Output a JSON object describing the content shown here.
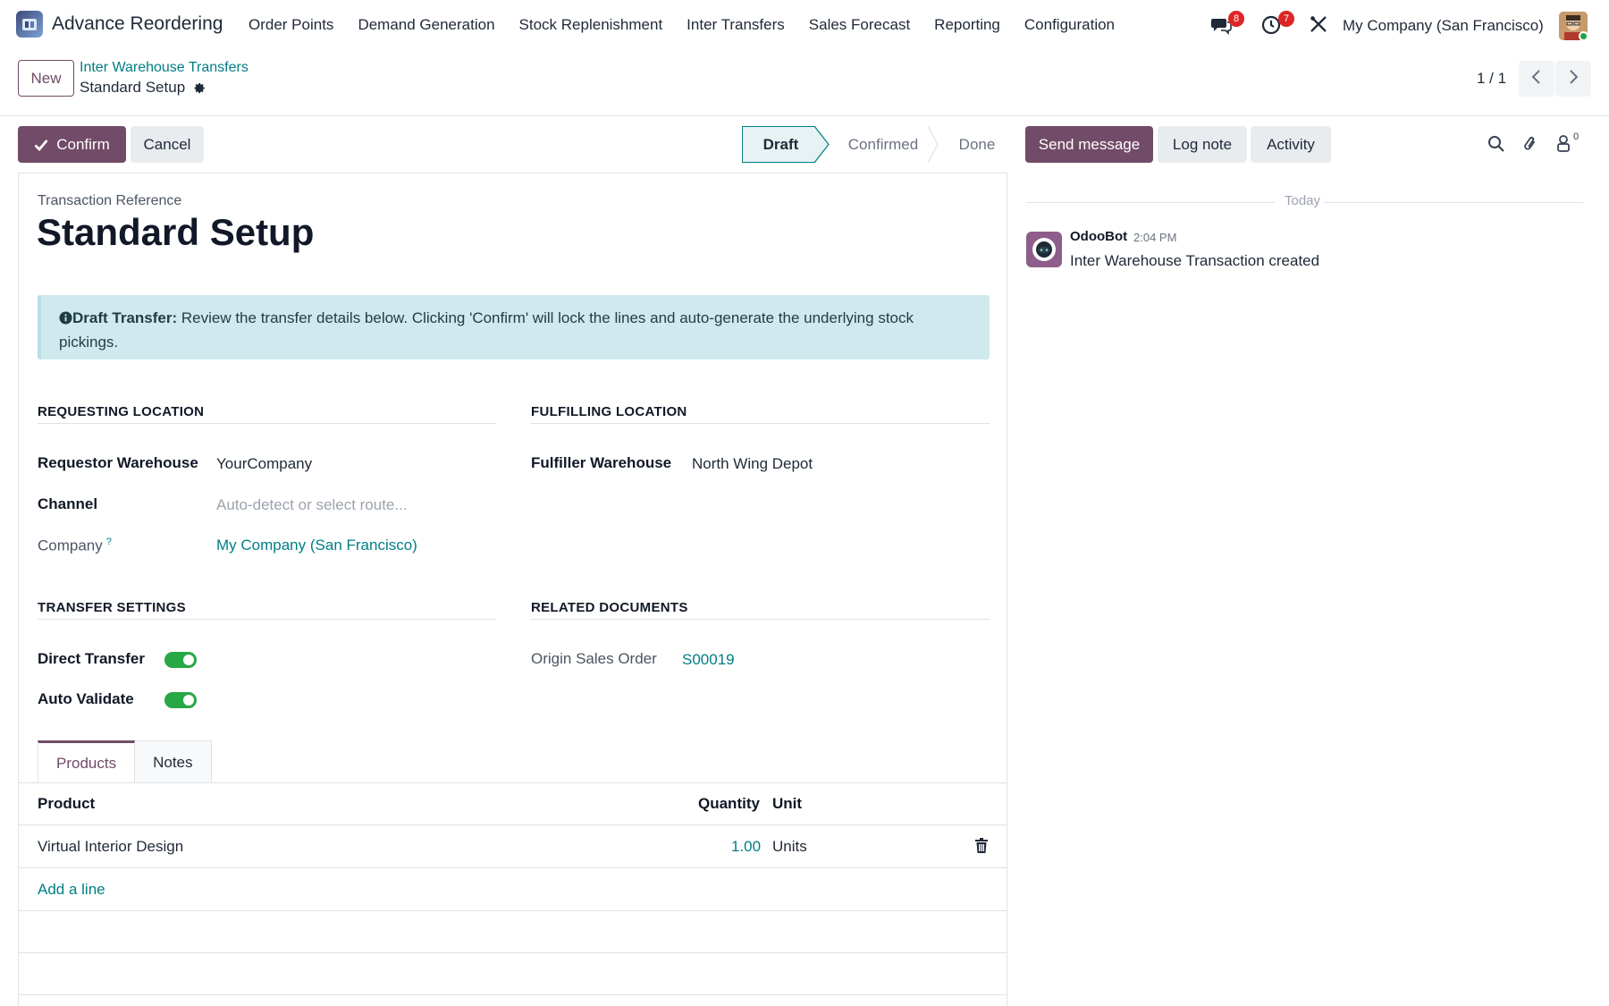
{
  "app": {
    "name": "Advance Reordering",
    "menu": [
      "Order Points",
      "Demand Generation",
      "Stock Replenishment",
      "Inter Transfers",
      "Sales Forecast",
      "Reporting",
      "Configuration"
    ],
    "messages_badge": "8",
    "activities_badge": "7",
    "company": "My Company (San Francisco)"
  },
  "control_panel": {
    "new_label": "New",
    "breadcrumb_parent": "Inter Warehouse Transfers",
    "breadcrumb_current": "Standard Setup",
    "pager": "1 / 1"
  },
  "actions": {
    "confirm": "Confirm",
    "cancel": "Cancel"
  },
  "status": {
    "stages": [
      "Draft",
      "Confirmed",
      "Done"
    ],
    "current": "Draft"
  },
  "form": {
    "reference_label": "Transaction Reference",
    "reference": "Standard Setup",
    "alert_title": "Draft Transfer:",
    "alert_text": "Review the transfer details below. Clicking 'Confirm' will lock the lines and auto-generate the underlying stock",
    "alert_text_2": "pickings.",
    "requesting": {
      "title": "REQUESTING LOCATION",
      "warehouse_label": "Requestor Warehouse",
      "warehouse": "YourCompany",
      "channel_label": "Channel",
      "channel_placeholder": "Auto-detect or select route...",
      "company_label": "Company",
      "company_help": "?",
      "company": "My Company (San Francisco)"
    },
    "fulfilling": {
      "title": "FULFILLING LOCATION",
      "warehouse_label": "Fulfiller Warehouse",
      "warehouse": "North Wing Depot"
    },
    "settings": {
      "title": "TRANSFER SETTINGS",
      "direct_label": "Direct Transfer",
      "direct": true,
      "auto_label": "Auto Validate",
      "auto": true
    },
    "related": {
      "title": "RELATED DOCUMENTS",
      "origin_label": "Origin Sales Order",
      "origin": "S00019"
    },
    "tabs": [
      "Products",
      "Notes"
    ],
    "lines": {
      "headers": {
        "product": "Product",
        "quantity": "Quantity",
        "unit": "Unit"
      },
      "rows": [
        {
          "product": "Virtual Interior Design",
          "quantity": "1.00",
          "unit": "Units"
        }
      ],
      "add_line": "Add a line"
    }
  },
  "chatter": {
    "send_message": "Send message",
    "log_note": "Log note",
    "activity": "Activity",
    "followers_count": "0",
    "date_label": "Today",
    "messages": [
      {
        "author": "OdooBot",
        "time": "2:04 PM",
        "body": "Inter Warehouse Transaction created"
      }
    ]
  },
  "colors": {
    "brand": "#714b67",
    "link": "#017e84",
    "toggle_on": "#28a745",
    "alert_bg": "#cfe9ee",
    "badge": "#dc2626"
  }
}
